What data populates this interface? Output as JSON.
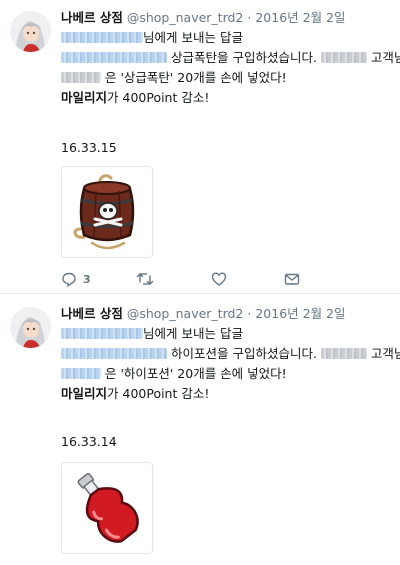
{
  "tweets": [
    {
      "name": "나베르 상점",
      "handle": "@shop_naver_trd2",
      "dot": "·",
      "date": "2016년 2월 2일",
      "reply_to": "님에게 보내는 답글",
      "line2_a": "상급폭탄을 구입하셨습니다.",
      "line2_b": "고객님",
      "line3": "은 '상급폭탄' 20개를 손에 넣었다!",
      "line4_bold": "마일리지",
      "line4_rest": "가 400Point 감소!",
      "timestamp": "16.33.15",
      "item_icon": "barrel-bomb",
      "reply_count": "3",
      "colors": {
        "link": "#1b95e0",
        "muted": "#657786"
      }
    },
    {
      "name": "나베르 상점",
      "handle": "@shop_naver_trd2",
      "dot": "·",
      "date": "2016년 2월 2일",
      "reply_to": "님에게 보내는 답글",
      "line2_a": "하이포션을 구입하셨습니다.",
      "line2_b": "고객님",
      "line3": "은 '하이포션' 20개를 손에 넣었다!",
      "line4_bold": "마일리지",
      "line4_rest": "가 400Point 감소!",
      "timestamp": "16.33.14",
      "item_icon": "red-potion"
    }
  ]
}
